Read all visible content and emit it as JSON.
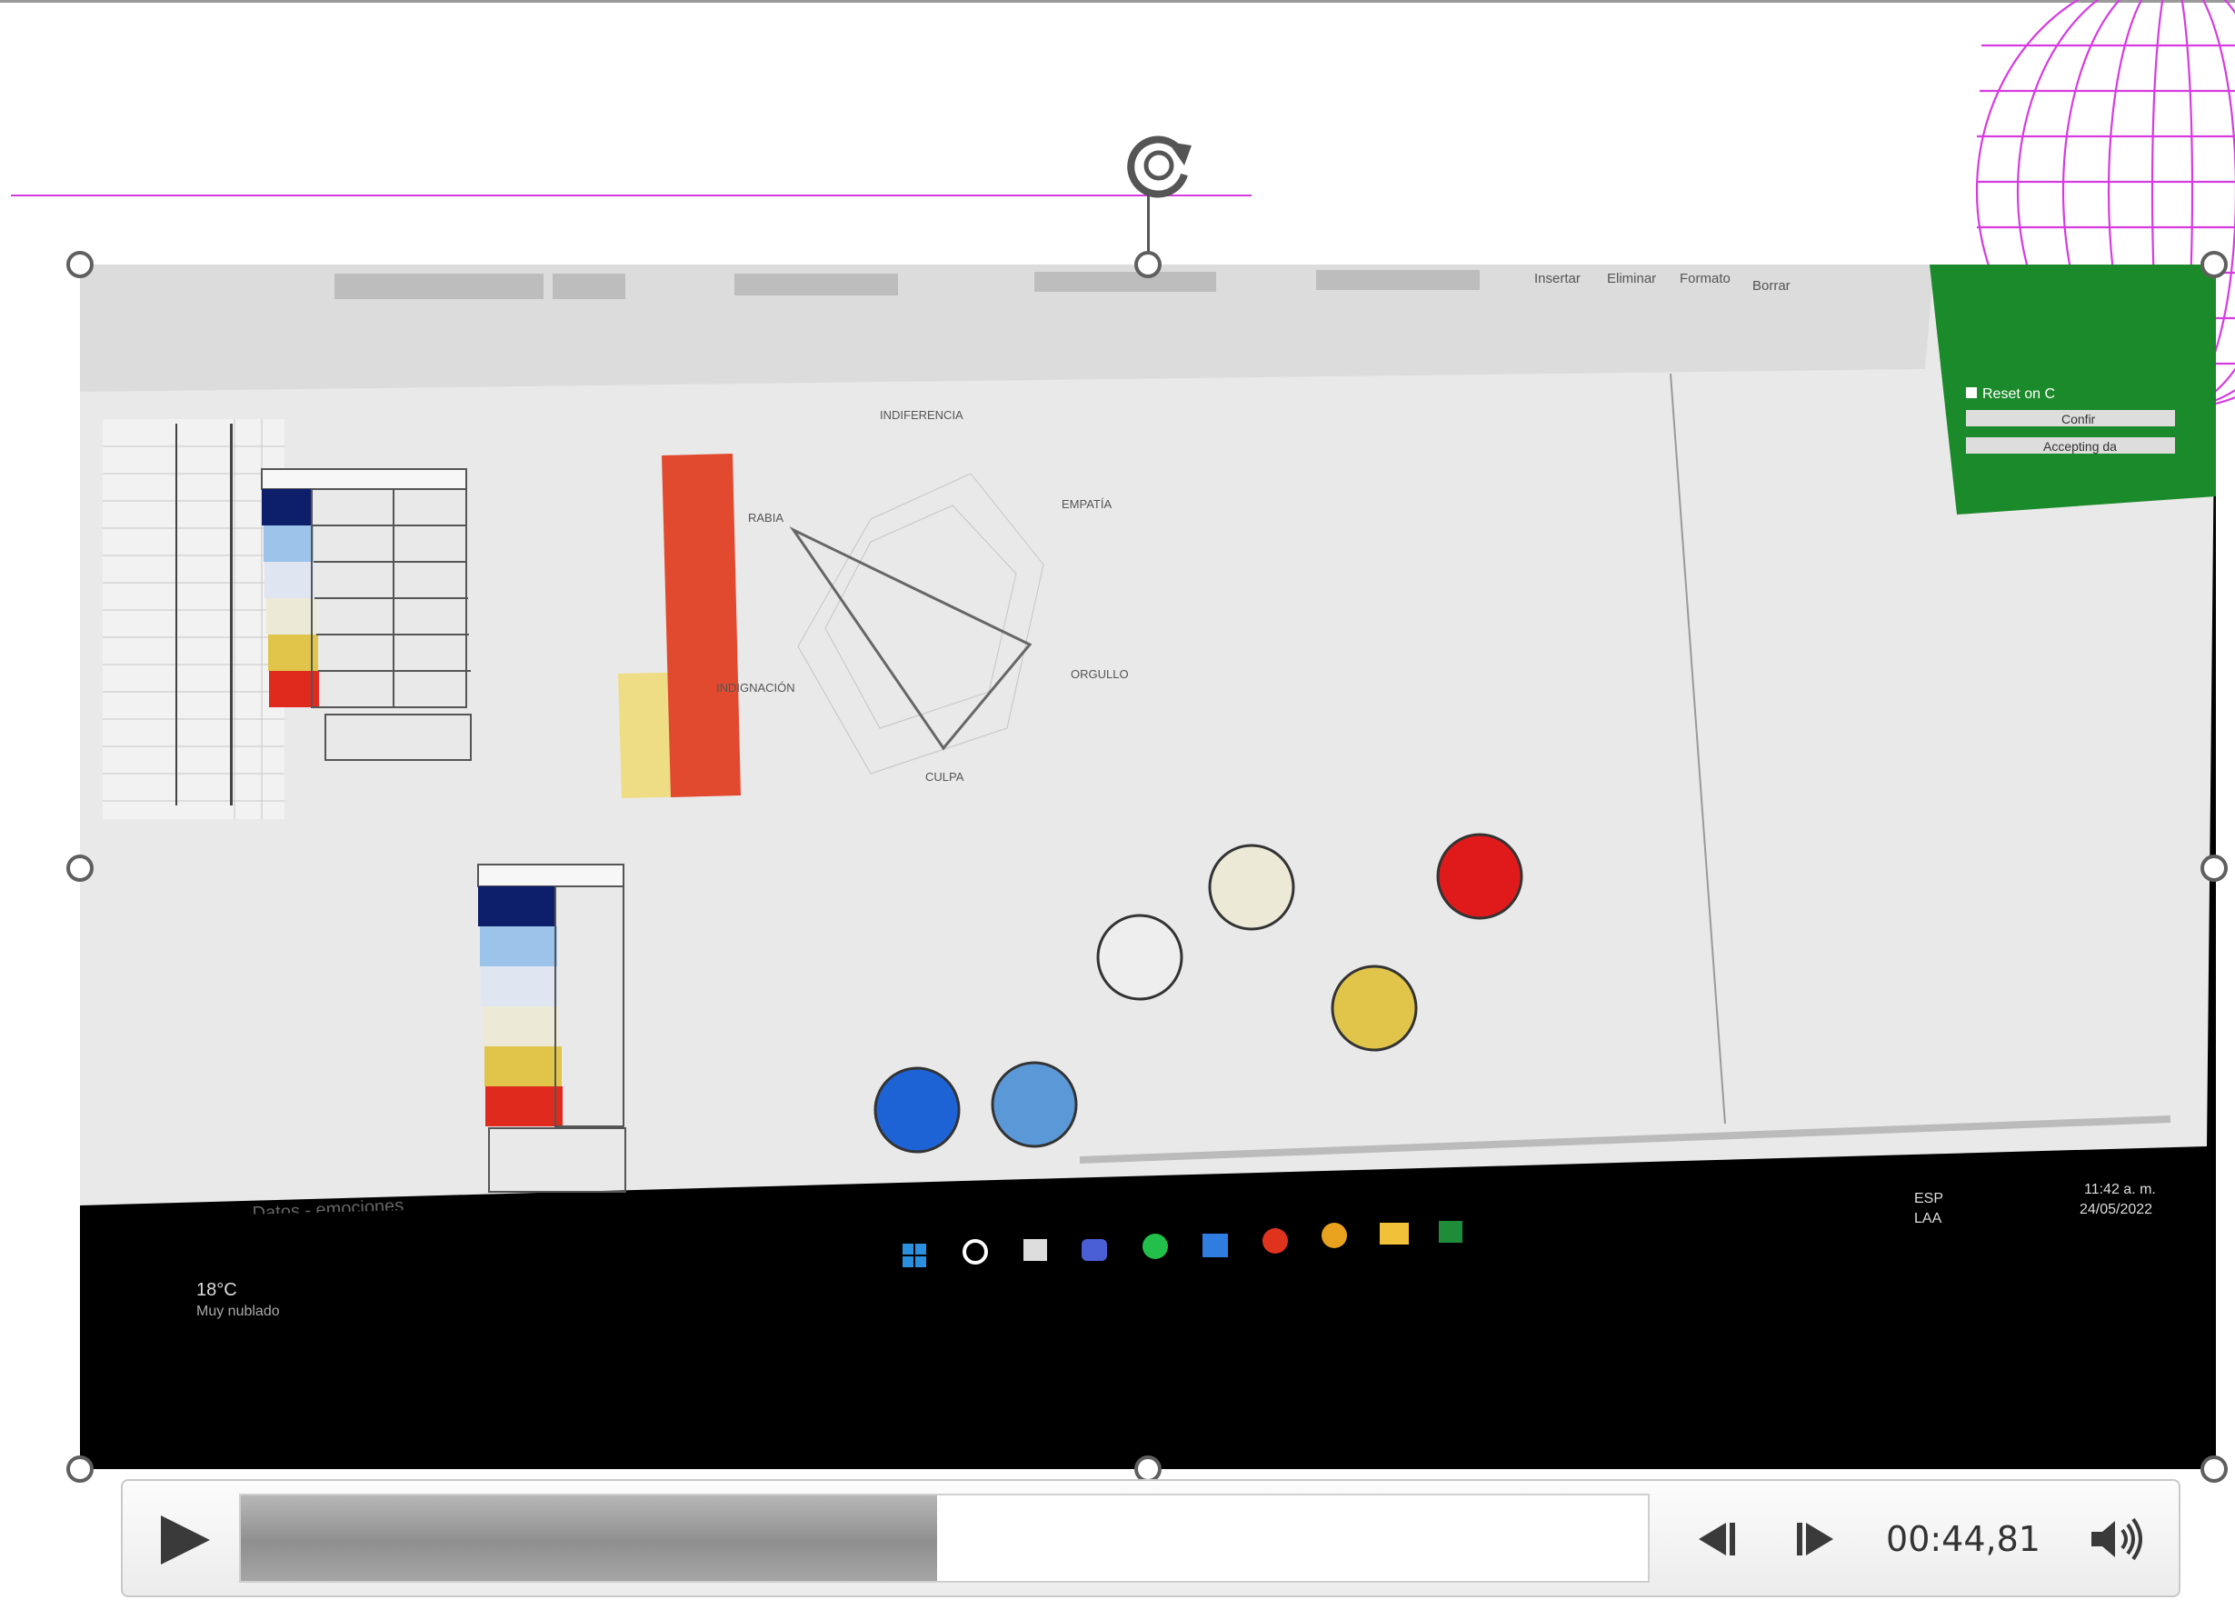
{
  "media": {
    "current_time": "00:44,81",
    "progress_fraction": 0.495
  },
  "icons": {
    "play": "play-icon",
    "rewind": "skip-back-icon",
    "forward": "skip-forward-icon",
    "volume": "volume-icon",
    "rotate": "rotate-handle-icon",
    "globe": "wireframe-globe-decoration"
  },
  "colors": {
    "accent_magenta": "#d63be0",
    "navy": "#0d1f6b",
    "light_blue": "#9cc3ea",
    "pale_blue": "#dfe6f2",
    "cream": "#ece9d6",
    "yellow": "#e0c54a",
    "red": "#e02a1e",
    "royal_blue": "#1e63d6",
    "sky_blue": "#5b98d8",
    "green_panel": "#1b8a2a"
  },
  "video_frame": {
    "ribbon_font_size_box": "Insertar",
    "ribbon_font_size_box2": "Eliminar",
    "ribbon_format_box": "Formato",
    "ribbon_delete": "Borrar",
    "radar_label_top": "INDIFERENCIA",
    "radar_label_right": "EMPATÍA",
    "radar_label_left": "RABIA",
    "radar_label_right2": "ORGULLO",
    "radar_label_left2": "INDIGNACIÓN",
    "radar_label_bottom": "CULPA",
    "panel_reset": "Reset on C",
    "panel_confirm": "Confir",
    "panel_accept": "Accepting da",
    "sheet_tab": "Datos - emociones",
    "weather_temp": "18°C",
    "weather_desc": "Muy nublado",
    "clock_time": "11:42 a. m.",
    "clock_date": "24/05/2022",
    "lang_top": "ESP",
    "lang_bottom": "LAA"
  }
}
